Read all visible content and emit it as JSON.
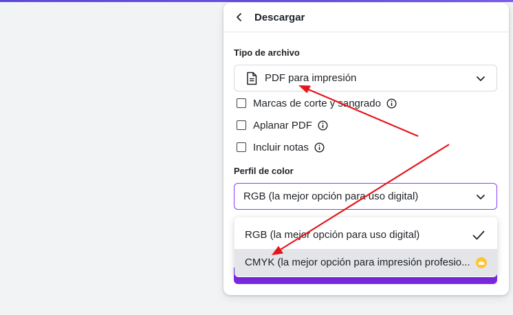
{
  "panel": {
    "title": "Descargar"
  },
  "file_type": {
    "label": "Tipo de archivo",
    "selected": "PDF para impresión",
    "icon": "document-icon"
  },
  "options": [
    {
      "label": "Marcas de corte y sangrado",
      "checked": false,
      "has_info": true
    },
    {
      "label": "Aplanar PDF",
      "checked": false,
      "has_info": true
    },
    {
      "label": "Incluir notas",
      "checked": false,
      "has_info": true
    }
  ],
  "color_profile": {
    "label": "Perfil de color",
    "selected": "RGB (la mejor opción para uso digital)",
    "menu": [
      {
        "label": "RGB (la mejor opción para uso digital)",
        "selected": true
      },
      {
        "label": "CMYK (la mejor opción para impresión profesio...",
        "premium": true
      }
    ]
  },
  "colors": {
    "accent": "#8b3dff",
    "primary_button": "#7d2ae8",
    "annotation_arrow": "#e5151b",
    "premium_crown": "#ffc42d"
  }
}
